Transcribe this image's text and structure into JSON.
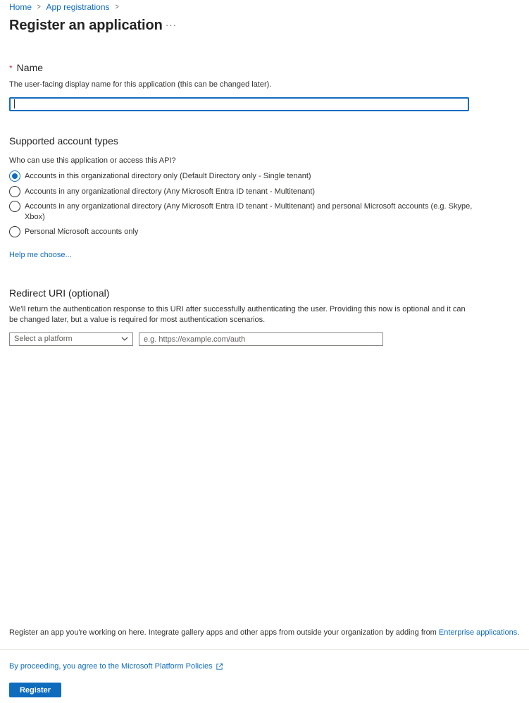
{
  "breadcrumb": {
    "home": "Home",
    "app_registrations": "App registrations"
  },
  "page": {
    "title": "Register an application",
    "more": "···"
  },
  "name_section": {
    "required_mark": "*",
    "title": "Name",
    "description": "The user-facing display name for this application (this can be changed later).",
    "value": ""
  },
  "account_types": {
    "title": "Supported account types",
    "question": "Who can use this application or access this API?",
    "options": [
      {
        "label": "Accounts in this organizational directory only (Default Directory only - Single tenant)",
        "selected": true
      },
      {
        "label": "Accounts in any organizational directory (Any Microsoft Entra ID tenant - Multitenant)",
        "selected": false
      },
      {
        "label": "Accounts in any organizational directory (Any Microsoft Entra ID tenant - Multitenant) and personal Microsoft accounts (e.g. Skype, Xbox)",
        "selected": false
      },
      {
        "label": "Personal Microsoft accounts only",
        "selected": false
      }
    ],
    "help_link": "Help me choose..."
  },
  "redirect": {
    "title": "Redirect URI (optional)",
    "description": "We'll return the authentication response to this URI after successfully authenticating the user. Providing this now is optional and it can be changed later, but a value is required for most authentication scenarios.",
    "platform_select": "Select a platform",
    "uri_placeholder": "e.g. https://example.com/auth"
  },
  "footer": {
    "text": "Register an app you're working on here. Integrate gallery apps and other apps from outside your organization by adding from",
    "link": "Enterprise applications",
    "period": ".",
    "policy": "By proceeding, you agree to the Microsoft Platform Policies",
    "register": "Register"
  }
}
